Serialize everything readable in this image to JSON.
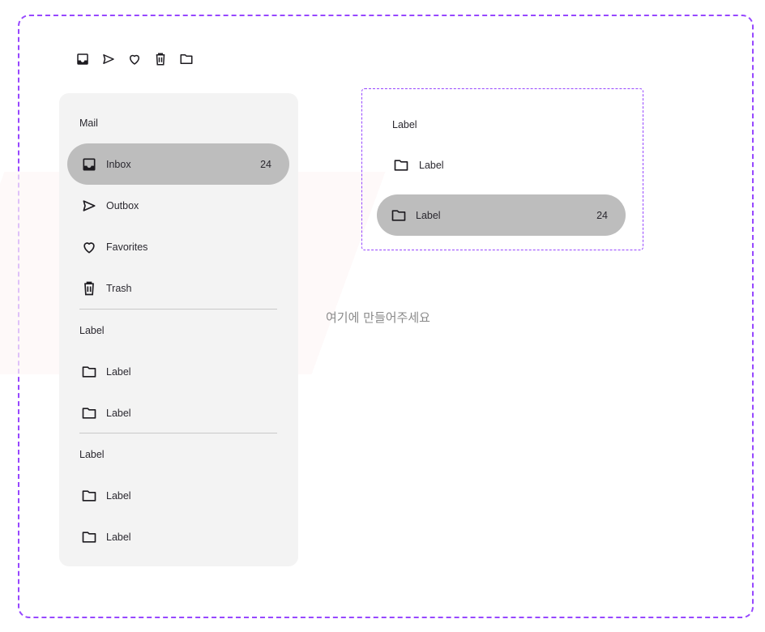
{
  "toolbar": {
    "icons": [
      "inbox-icon",
      "send-icon",
      "heart-icon",
      "trash-icon",
      "folder-icon"
    ]
  },
  "nav": {
    "mail_header": "Mail",
    "items": [
      {
        "label": "Inbox",
        "badge": "24",
        "icon": "inbox-icon",
        "active": true
      },
      {
        "label": "Outbox",
        "badge": "",
        "icon": "send-icon",
        "active": false
      },
      {
        "label": "Favorites",
        "badge": "",
        "icon": "heart-icon",
        "active": false
      },
      {
        "label": "Trash",
        "badge": "",
        "icon": "trash-icon",
        "active": false
      }
    ],
    "sections": [
      {
        "header": "Label",
        "items": [
          {
            "label": "Label",
            "icon": "folder-icon"
          },
          {
            "label": "Label",
            "icon": "folder-icon"
          }
        ]
      },
      {
        "header": "Label",
        "items": [
          {
            "label": "Label",
            "icon": "folder-icon"
          },
          {
            "label": "Label",
            "icon": "folder-icon"
          }
        ]
      }
    ]
  },
  "preview": {
    "header": "Label",
    "plain_item": {
      "label": "Label",
      "icon": "folder-icon"
    },
    "active_item": {
      "label": "Label",
      "badge": "24",
      "icon": "folder-icon"
    }
  },
  "hint": "여기에 만들어주세요",
  "colors": {
    "frame_border": "#9747ff",
    "nav_background": "#f3f3f3",
    "active_indicator": "#bdbdbd",
    "text": "#2a282f",
    "hint_text": "#8a8a8a"
  }
}
